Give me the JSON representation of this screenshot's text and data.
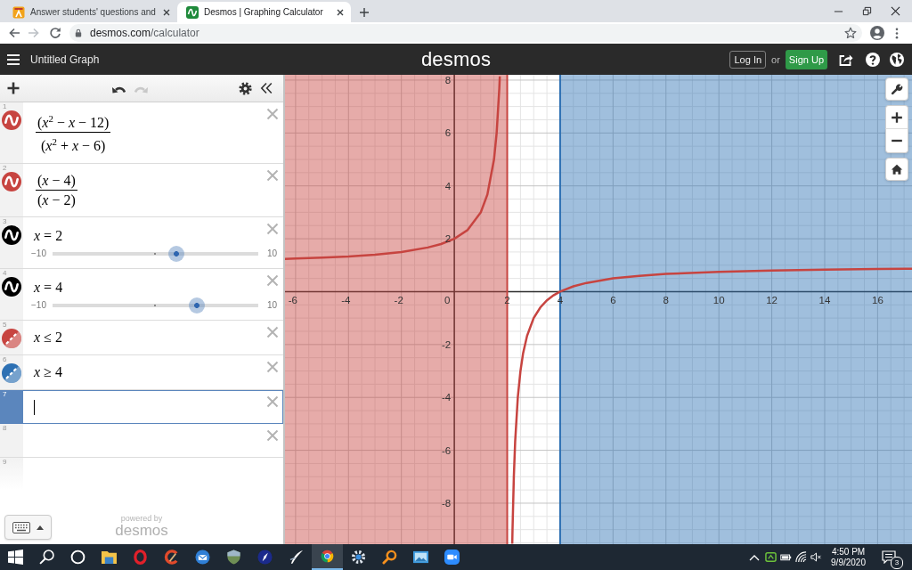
{
  "browser": {
    "tabs": [
      {
        "kind": "board",
        "title": "Answer students' questions and",
        "selected": false
      },
      {
        "kind": "wave",
        "title": "Desmos | Graphing Calculator",
        "selected": true
      }
    ],
    "back": {
      "disabled": false
    },
    "forward": {
      "disabled": true
    },
    "url_host": "desmos.com",
    "url_path": "/calculator"
  },
  "header": {
    "title": "Untitled Graph",
    "logo": "desmos",
    "login": "Log In",
    "or": "or",
    "signup": "Sign Up"
  },
  "toolbar": {
    "undo": {
      "disabled": false
    },
    "redo": {
      "disabled": true
    }
  },
  "expressions": [
    {
      "index": "1",
      "kind": "fraction",
      "color": "#c74440",
      "numerator": "(*x*$^{2}$ − *x* − 12)",
      "denominator": "(*x*$^{2}$ + *x* − 6)",
      "selected": false
    },
    {
      "index": "2",
      "kind": "fraction",
      "color": "#c74440",
      "numerator": "(*x* − 4)",
      "denominator": "(*x* − 2)",
      "selected": false
    },
    {
      "index": "3",
      "kind": "slider",
      "color": "#000000",
      "latex": "*x* = 2",
      "min": "−10",
      "max": "10",
      "level": 0.6,
      "selected": false
    },
    {
      "index": "4",
      "kind": "slider",
      "color": "#000000",
      "latex": "*x* = 4",
      "min": "−10",
      "max": "10",
      "level": 0.7,
      "selected": false
    },
    {
      "index": "5",
      "kind": "inequality",
      "color": "#c74440",
      "latex": "*x* ≤ 2",
      "selected": false
    },
    {
      "index": "6",
      "kind": "inequality",
      "color": "#2d70b3",
      "latex": "*x* ≥ 4",
      "selected": false
    },
    {
      "index": "7",
      "kind": "empty",
      "selected": true
    },
    {
      "index": "8",
      "kind": "empty",
      "selected": false
    },
    {
      "index": "9",
      "kind": "new",
      "selected": false
    }
  ],
  "footer": {
    "powered_by": "powered by",
    "brand": "desmos"
  },
  "graph": {
    "chart_data": {
      "type": "line",
      "x": [
        -6.4,
        -6,
        -5,
        -4,
        -3,
        -2,
        -1,
        -0.5,
        0,
        0.5,
        1,
        1.25,
        1.5,
        1.6,
        1.7,
        1.72,
        2.19,
        2.2,
        2.25,
        2.3,
        2.4,
        2.5,
        2.6,
        2.75,
        3,
        3.25,
        3.5,
        3.75,
        4,
        4.5,
        5,
        6,
        7,
        8,
        10,
        12,
        14,
        16,
        17.3
      ],
      "series": [
        {
          "color": "#c74440",
          "values": [
            1.24,
            1.25,
            1.29,
            1.33,
            1.4,
            1.5,
            1.67,
            1.8,
            2,
            2.33,
            3,
            3.67,
            5,
            6,
            7.67,
            8.14,
            -9.53,
            -9,
            -7,
            -5.67,
            -4,
            -3,
            -2.33,
            -1.67,
            -1,
            -0.6,
            -0.33,
            -0.14,
            0,
            0.2,
            0.33,
            0.5,
            0.6,
            0.67,
            0.75,
            0.8,
            0.83,
            0.86,
            0.87
          ]
        }
      ],
      "xlim": [
        -6.4,
        17.3
      ],
      "ylim": [
        -9.55,
        8.2
      ],
      "xticks": [
        -6,
        -4,
        -2,
        0,
        2,
        4,
        6,
        8,
        10,
        12,
        14,
        16
      ],
      "yticks": [
        -8,
        -6,
        -4,
        -2,
        2,
        4,
        6,
        8
      ],
      "grid": true,
      "bands": [
        {
          "axis": "x",
          "from": -6.4,
          "to": 2,
          "color": "#c74440"
        },
        {
          "axis": "x",
          "from": 4,
          "to": 17.3,
          "color": "#2d70b3"
        }
      ],
      "ref_lines": [
        {
          "axis": "x",
          "value": 2,
          "color": "#c74440"
        },
        {
          "axis": "x",
          "value": 4,
          "color": "#2d70b3"
        }
      ]
    }
  },
  "taskbar": {
    "apps": [
      {
        "kind": "start",
        "selected": false
      },
      {
        "kind": "search",
        "selected": false
      },
      {
        "kind": "assistant",
        "selected": false
      },
      {
        "kind": "files",
        "selected": false
      },
      {
        "kind": "ring",
        "selected": false
      },
      {
        "kind": "arc",
        "selected": false
      },
      {
        "kind": "mail",
        "selected": false
      },
      {
        "kind": "shield",
        "selected": false
      },
      {
        "kind": "compass",
        "selected": false
      },
      {
        "kind": "quill",
        "selected": false
      },
      {
        "kind": "browser",
        "selected": true
      },
      {
        "kind": "gear",
        "selected": false
      },
      {
        "kind": "magnifier",
        "selected": false
      },
      {
        "kind": "photos",
        "selected": false
      },
      {
        "kind": "video",
        "selected": false
      }
    ],
    "time": "4:50 PM",
    "date": "9/9/2020",
    "notifications": "3"
  }
}
